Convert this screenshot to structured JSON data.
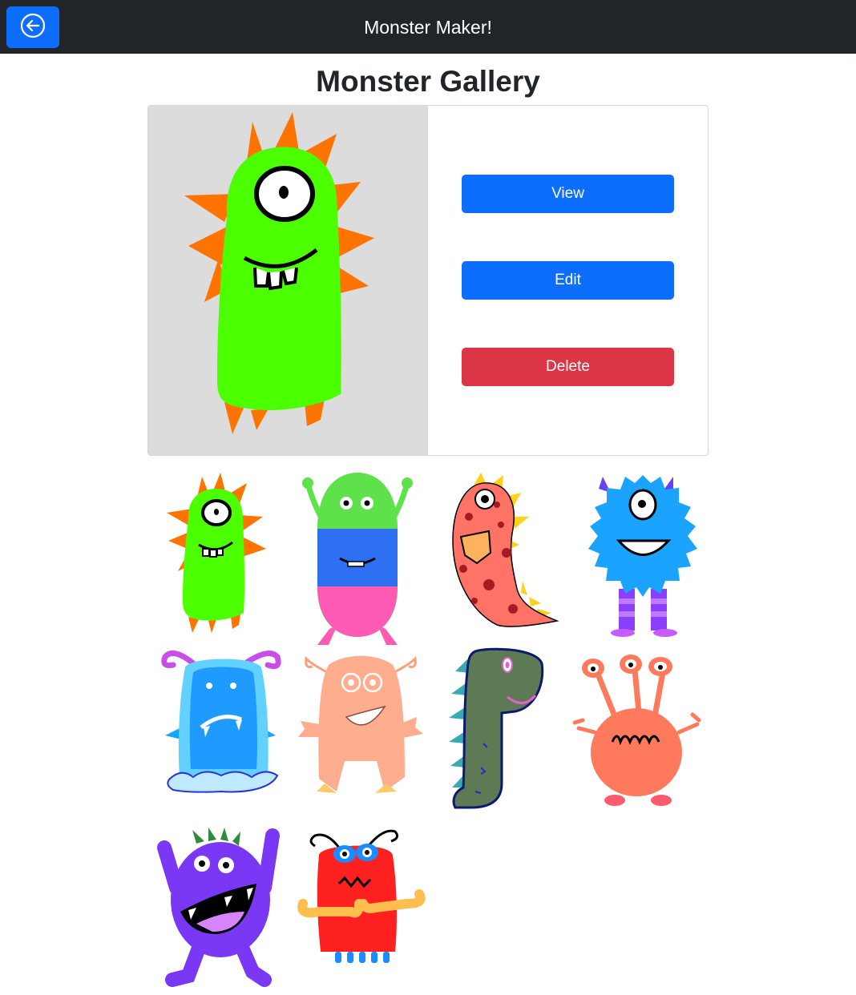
{
  "header": {
    "back_icon": "back-arrow-circle-icon",
    "title": "Monster Maker!"
  },
  "page": {
    "title": "Monster Gallery"
  },
  "selected": {
    "monster": "green-cyclops-monster",
    "actions": {
      "view_label": "View",
      "edit_label": "Edit",
      "delete_label": "Delete"
    }
  },
  "gallery": [
    "green-cyclops-monster",
    "green-blue-pink-alien-monster",
    "red-dino-monster",
    "blue-furry-monster",
    "blue-ghost-monster",
    "peach-monster",
    "green-dino-monster",
    "orange-three-eyed-monster",
    "purple-monster",
    "red-bug-monster"
  ],
  "colors": {
    "navbar": "#212529",
    "primary": "#0d6efd",
    "danger": "#dc3545",
    "preview_bg": "#dcdcdc"
  }
}
